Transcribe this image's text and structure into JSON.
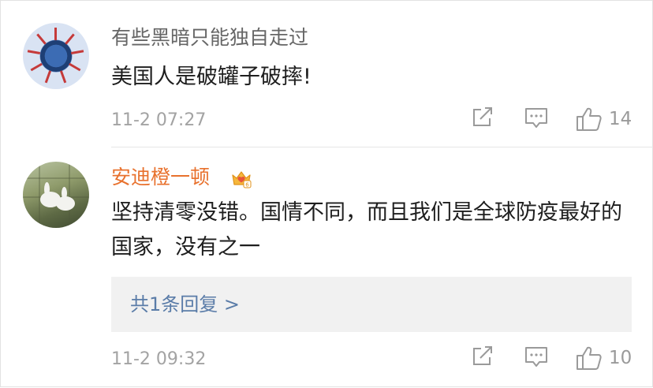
{
  "comments": [
    {
      "username": "有些黑暗只能独自走过",
      "avatar_icon": "virus-avatar",
      "text": "美国人是破罐子破摔!",
      "time": "11-2 07:27",
      "like_count": "14"
    },
    {
      "username": "安迪橙一顿",
      "avatar_icon": "goose-avatar",
      "badge_icon": "vip-crown-icon",
      "text": "坚持清零没错。国情不同，而且我们是全球防疫最好的国家，没有之一",
      "reply_link": "共1条回复 >",
      "time": "11-2 09:32",
      "like_count": "10"
    }
  ],
  "colors": {
    "username_gray": "#666666",
    "username_vip": "#e8712d",
    "reply_link": "#5a7ca8",
    "meta_gray": "#a3a3a3",
    "reply_box_bg": "#f1f1f1"
  }
}
